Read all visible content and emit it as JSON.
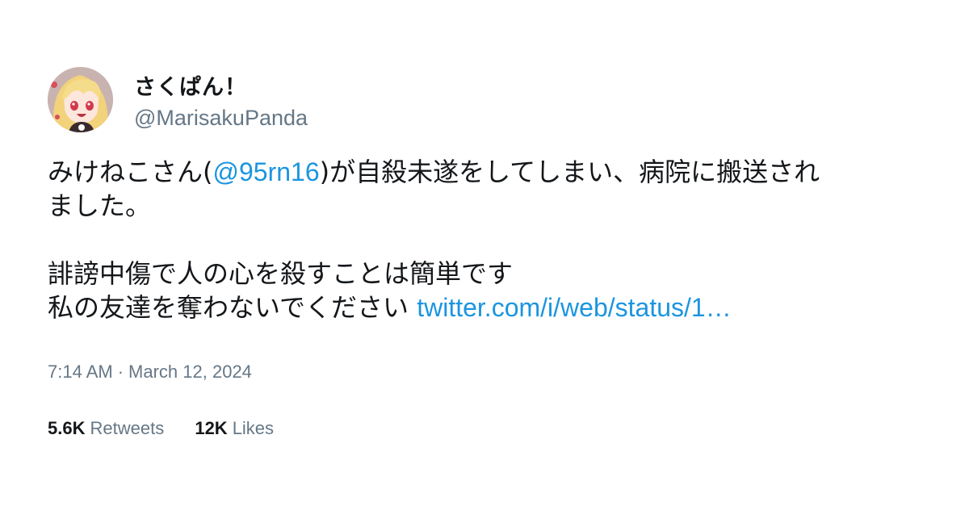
{
  "user": {
    "display_name": "さくぱん！",
    "handle": "@MarisakuPanda",
    "avatar_icon": "anime-girl-avatar"
  },
  "tweet": {
    "line1_prefix": "みけねこさん(",
    "mention": "@95rn16",
    "line1_suffix": ")が自殺未遂をしてしまい、病院に搬送され",
    "line2": "ました。",
    "line3": "誹謗中傷で人の心を殺すことは簡単です",
    "line4_prefix": "私の友達を奪わないでください ",
    "link": "twitter.com/i/web/status/1…"
  },
  "meta": {
    "time": "7:14 AM",
    "separator": "·",
    "date": "March 12, 2024"
  },
  "stats": {
    "retweets_count": "5.6K",
    "retweets_label": "Retweets",
    "likes_count": "12K",
    "likes_label": "Likes"
  },
  "colors": {
    "link": "#1b95e0",
    "secondary_text": "#657786",
    "primary_text": "#14171a"
  }
}
